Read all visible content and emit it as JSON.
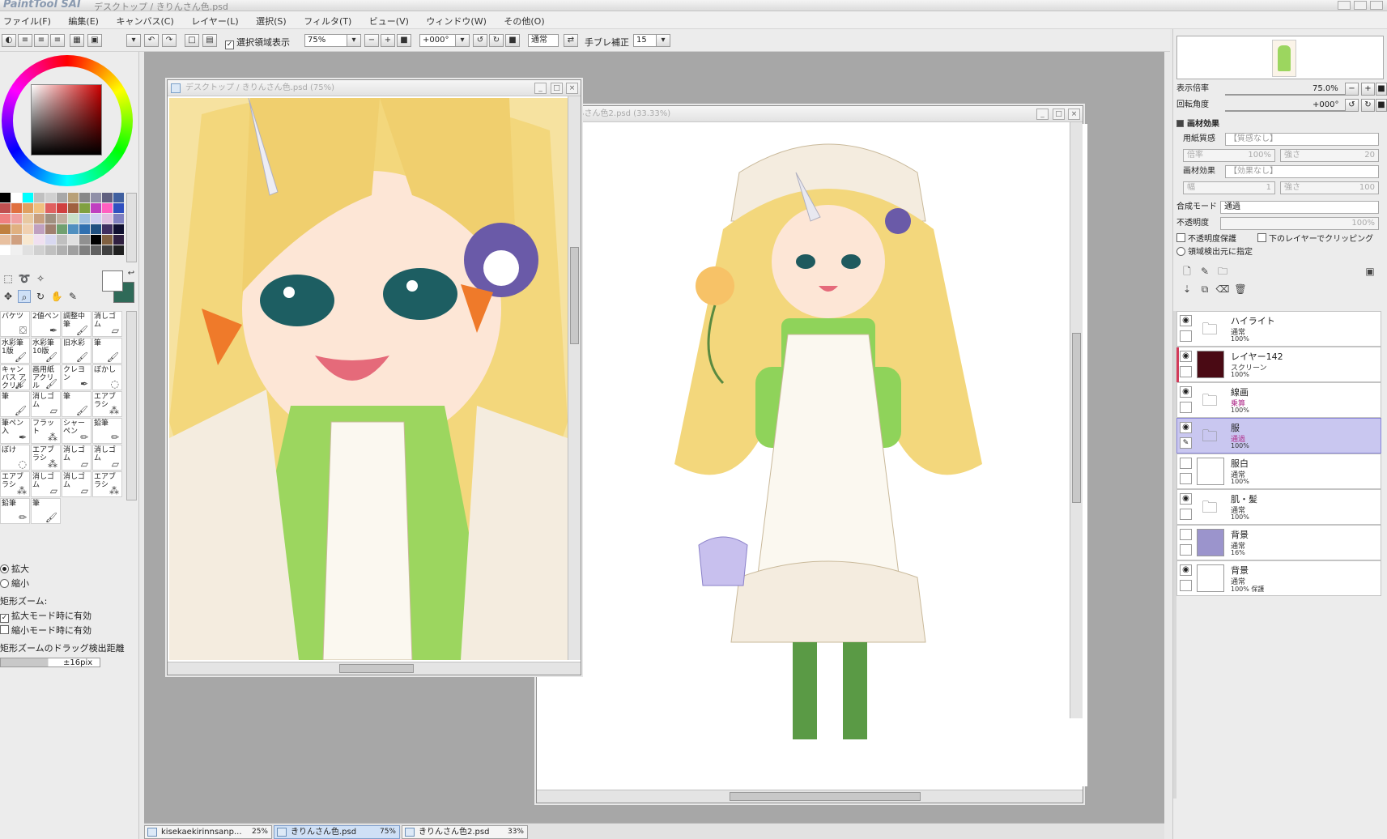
{
  "window": {
    "app_logo": "PaintTool SAI",
    "title": "デスクトップ / きりんさん色.psd"
  },
  "menu": [
    "ファイル(F)",
    "編集(E)",
    "キャンバス(C)",
    "レイヤー(L)",
    "選択(S)",
    "フィルタ(T)",
    "ビュー(V)",
    "ウィンドウ(W)",
    "その他(O)"
  ],
  "toolbar": {
    "show_selection_label": "選択領域表示",
    "show_selection_checked": true,
    "zoom_value": "75%",
    "rotation_value": "+000°",
    "blend_value": "通常",
    "stabilizer_label": "手ブレ補正",
    "stabilizer_value": "15"
  },
  "colors": {
    "accent_selection": "#c9c7f0",
    "canvas_bg": "#a7a7a7",
    "fg_color": "#ffffff",
    "bg_color": "#2f6a58",
    "layer_142_color": "#4a0a14",
    "layer_haikei_color": "#9b94cc"
  },
  "palette": [
    "#000000",
    "#ffffff",
    "#00ffff",
    "#c0c0c0",
    "#d0d0d0",
    "#a8a8a8",
    "#b8a078",
    "#888888",
    "#9090a8",
    "#606080",
    "#4060a0",
    "#c05050",
    "#e07040",
    "#e0a060",
    "#f0c080",
    "#e06060",
    "#d04040",
    "#a06040",
    "#80a040",
    "#c040c0",
    "#ff60c0",
    "#3050c0",
    "#f08080",
    "#f0a0a0",
    "#e8c8a0",
    "#c8a080",
    "#a09080",
    "#c0b0a0",
    "#c8e0c8",
    "#a0c0e0",
    "#d0d0f0",
    "#e0c0e0",
    "#8080c0",
    "#c08040",
    "#e0b080",
    "#f0d0b0",
    "#c0a0c0",
    "#a08070",
    "#70a070",
    "#5090c0",
    "#3070b0",
    "#205080",
    "#403060",
    "#101030",
    "#e8c0a0",
    "#d0a080",
    "#f8e8d0",
    "#f0e0f0",
    "#d8d8f0",
    "#c0c0c0",
    "#e0e0e0",
    "#909090",
    "#000000",
    "#806040",
    "#302040",
    "#ffffff",
    "#f0f0f0",
    "#e0e0e0",
    "#d0d0d0",
    "#c0c0c0",
    "#b0b0b0",
    "#a0a0a0",
    "#808080",
    "#606060",
    "#404040",
    "#202020"
  ],
  "tools": [
    {
      "label": "バケツ",
      "icon": "bucket-icon"
    },
    {
      "label": "2値ペン",
      "icon": "pen-icon"
    },
    {
      "label": "調整中筆",
      "icon": "brush-icon"
    },
    {
      "label": "消しゴム",
      "icon": "eraser-icon"
    },
    {
      "label": "水彩筆 1版",
      "icon": "brush-icon"
    },
    {
      "label": "水彩筆 10版",
      "icon": "brush-icon"
    },
    {
      "label": "旧水彩",
      "icon": "brush-icon"
    },
    {
      "label": "筆",
      "icon": "brush-icon"
    },
    {
      "label": "キャンバス アクリル",
      "icon": "brush-icon"
    },
    {
      "label": "画用紙 アクリル",
      "icon": "brush-icon"
    },
    {
      "label": "クレヨン",
      "icon": "pen-icon"
    },
    {
      "label": "ぼかし",
      "icon": "blur-icon"
    },
    {
      "label": "筆",
      "icon": "brush-icon"
    },
    {
      "label": "消しゴム",
      "icon": "eraser-icon"
    },
    {
      "label": "筆",
      "icon": "brush-icon"
    },
    {
      "label": "エアブラシ",
      "icon": "airbrush-icon"
    },
    {
      "label": "筆ペン入",
      "icon": "pen-icon"
    },
    {
      "label": "フラット",
      "icon": "airbrush-icon"
    },
    {
      "label": "シャーペン",
      "icon": "pencil-icon"
    },
    {
      "label": "鉛筆",
      "icon": "pencil-icon"
    },
    {
      "label": "ぼけ",
      "icon": "blur-icon"
    },
    {
      "label": "エアブラシ",
      "icon": "airbrush-icon"
    },
    {
      "label": "消しゴム",
      "icon": "eraser-icon"
    },
    {
      "label": "消しゴム",
      "icon": "eraser-icon"
    },
    {
      "label": "エアブラシ",
      "icon": "airbrush-icon"
    },
    {
      "label": "消しゴム",
      "icon": "eraser-icon"
    },
    {
      "label": "消しゴム",
      "icon": "eraser-icon"
    },
    {
      "label": "エアブラシ",
      "icon": "airbrush-icon"
    },
    {
      "label": "鉛筆",
      "icon": "pencil-icon"
    },
    {
      "label": "筆",
      "icon": "brush-icon"
    }
  ],
  "zoom_options": {
    "zoom_in": "拡大",
    "zoom_out": "縮小",
    "rect_zoom_label": "矩形ズーム:",
    "enable_zoom_in": "拡大モード時に有効",
    "enable_zoom_in_checked": true,
    "enable_zoom_out": "縮小モード時に有効",
    "enable_zoom_out_checked": false,
    "drag_distance_label": "矩形ズームのドラッグ検出距離",
    "drag_distance_value": "±16pix"
  },
  "documents": [
    {
      "title": "デスクトップ / きりんさん色.psd (75%)"
    },
    {
      "title": "/ きりんさん色2.psd (33.33%)"
    }
  ],
  "taskbar": [
    {
      "name": "kisekaekirinnsanp...",
      "pct": "25%",
      "active": false
    },
    {
      "name": "きりんさん色.psd",
      "pct": "75%",
      "active": true
    },
    {
      "name": "きりんさん色2.psd",
      "pct": "33%",
      "active": false
    }
  ],
  "navigator": {
    "zoom_label": "表示倍率",
    "zoom_value": "75.0%",
    "rotation_label": "回転角度",
    "rotation_value": "+000°"
  },
  "texture": {
    "header": "画材効果",
    "paper_label": "用紙質感",
    "paper_value": "【質感なし】",
    "scale_label": "倍率",
    "scale_value": "100%",
    "strength_label": "強さ",
    "strength_value": "20",
    "effect_label": "画材効果",
    "effect_value": "【効果なし】",
    "width_label": "幅",
    "width_value": "1",
    "effect_strength_label": "強さ",
    "effect_strength_value": "100"
  },
  "layer_props": {
    "blend_label": "合成モード",
    "blend_value": "通過",
    "opacity_label": "不透明度",
    "opacity_value": "100%",
    "preserve_opacity": "不透明度保護",
    "clip_below": "下のレイヤーでクリッピング",
    "selection_source": "領域検出元に指定"
  },
  "layers": [
    {
      "name": "ハイライト",
      "mode": "通常",
      "opacity": "100%",
      "folder": true,
      "visible": true,
      "selected": false
    },
    {
      "name": "レイヤー142",
      "mode": "スクリーン",
      "opacity": "100%",
      "folder": false,
      "visible": true,
      "selected": false,
      "thumb": "#4a0a14",
      "accent": true
    },
    {
      "name": "線画",
      "mode": "乗算",
      "opacity": "100%",
      "folder": true,
      "visible": true,
      "selected": false,
      "pink": true
    },
    {
      "name": "服",
      "mode": "通過",
      "opacity": "100%",
      "folder": true,
      "visible": true,
      "selected": true,
      "pink": true
    },
    {
      "name": "服白",
      "mode": "通常",
      "opacity": "100%",
      "folder": false,
      "visible": false,
      "selected": false,
      "thumb": "#ffffff"
    },
    {
      "name": "肌・髪",
      "mode": "通常",
      "opacity": "100%",
      "folder": true,
      "visible": true,
      "selected": false
    },
    {
      "name": "背景",
      "mode": "通常",
      "opacity": "16%",
      "folder": false,
      "visible": false,
      "selected": false,
      "thumb": "#9b94cc"
    },
    {
      "name": "背景",
      "mode": "通常",
      "opacity": "100% 保護",
      "folder": false,
      "visible": true,
      "selected": false,
      "thumb": "#ffffff"
    }
  ]
}
